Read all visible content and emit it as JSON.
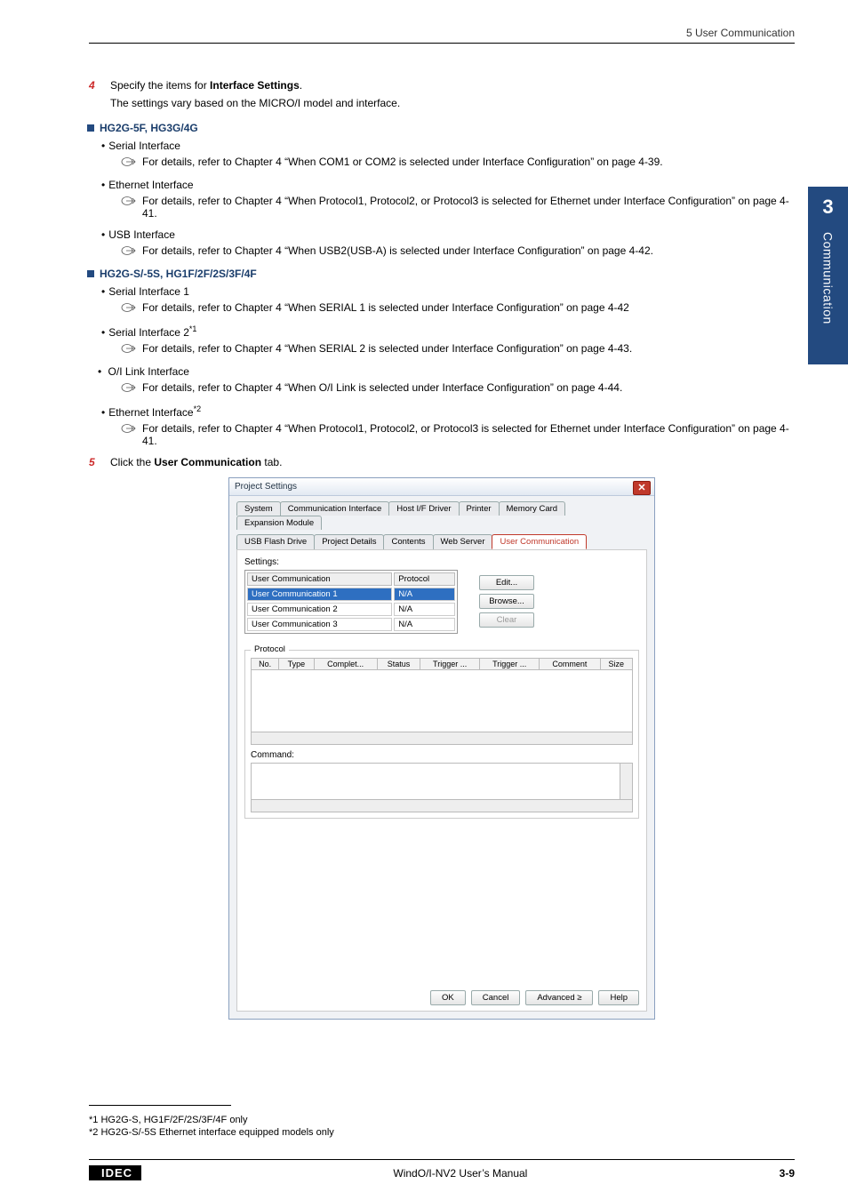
{
  "header": {
    "section": "5 User Communication"
  },
  "sideTab": {
    "number": "3",
    "label": "Communication"
  },
  "step4": {
    "num": "4",
    "text_pre": "Specify the items for ",
    "text_bold": "Interface Settings",
    "text_post": ".",
    "sub": "The settings vary based on the MICRO/I model and interface."
  },
  "secA": {
    "title": "HG2G-5F, HG3G/4G",
    "items": [
      {
        "label": "Serial Interface",
        "ref": "For details, refer to Chapter 4 “When COM1 or COM2 is selected under Interface Configuration” on page 4-39."
      },
      {
        "label": "Ethernet Interface",
        "ref": "For details, refer to Chapter 4 “When Protocol1, Protocol2, or Protocol3 is selected for Ethernet under Interface Configuration” on page 4-41."
      },
      {
        "label": "USB Interface",
        "ref": "For details, refer to Chapter 4 “When USB2(USB-A) is selected under Interface Configuration” on page 4-42."
      }
    ]
  },
  "secB": {
    "title": "HG2G-S/-5S, HG1F/2F/2S/3F/4F",
    "items": [
      {
        "label": "Serial Interface 1",
        "sup": "",
        "ref": "For details, refer to Chapter 4 “When SERIAL 1 is selected under Interface Configuration” on page 4-42"
      },
      {
        "label": "Serial Interface 2",
        "sup": "*1",
        "ref": "For details, refer to Chapter 4 “When SERIAL 2 is selected under Interface Configuration” on page 4-43."
      },
      {
        "label": "O/I Link Interface",
        "sup": "",
        "ref": "For details, refer to Chapter 4 “When O/I Link is selected under Interface Configuration” on page 4-44."
      },
      {
        "label": "Ethernet Interface",
        "sup": "*2",
        "ref": "For details, refer to Chapter 4 “When Protocol1, Protocol2, or Protocol3 is selected for Ethernet under Interface Configuration” on page 4-41."
      }
    ]
  },
  "step5": {
    "num": "5",
    "text_pre": "Click the ",
    "text_bold": "User Communication",
    "text_post": " tab."
  },
  "dialog": {
    "title": "Project Settings",
    "tabsRow1": [
      "System",
      "Communication Interface",
      "Host I/F Driver",
      "Printer",
      "Memory Card",
      "Expansion Module"
    ],
    "tabsRow2": [
      "USB Flash Drive",
      "Project Details",
      "Contents",
      "Web Server",
      "User Communication"
    ],
    "selectedTab": "User Communication",
    "settingsLabel": "Settings:",
    "settingsCols": [
      "User Communication",
      "Protocol"
    ],
    "settingsRows": [
      {
        "uc": "User Communication 1",
        "proto": "N/A",
        "hl": true
      },
      {
        "uc": "User Communication 2",
        "proto": "N/A",
        "hl": false
      },
      {
        "uc": "User Communication 3",
        "proto": "N/A",
        "hl": false
      }
    ],
    "sideButtons": {
      "edit": "Edit...",
      "browse": "Browse...",
      "clear": "Clear"
    },
    "protocolLegend": "Protocol",
    "protoCols": [
      "No.",
      "Type",
      "Complet...",
      "Status",
      "Trigger ...",
      "Trigger ...",
      "Comment",
      "Size"
    ],
    "commandLabel": "Command:",
    "footerButtons": {
      "ok": "OK",
      "cancel": "Cancel",
      "advanced": "Advanced ≥",
      "help": "Help"
    }
  },
  "footnotes": {
    "f1": "*1 HG2G-S, HG1F/2F/2S/3F/4F only",
    "f2": "*2 HG2G-S/-5S Ethernet interface equipped models only"
  },
  "footer": {
    "logo": "IDEC",
    "center": "WindO/I-NV2 User’s Manual",
    "page": "3-9"
  }
}
